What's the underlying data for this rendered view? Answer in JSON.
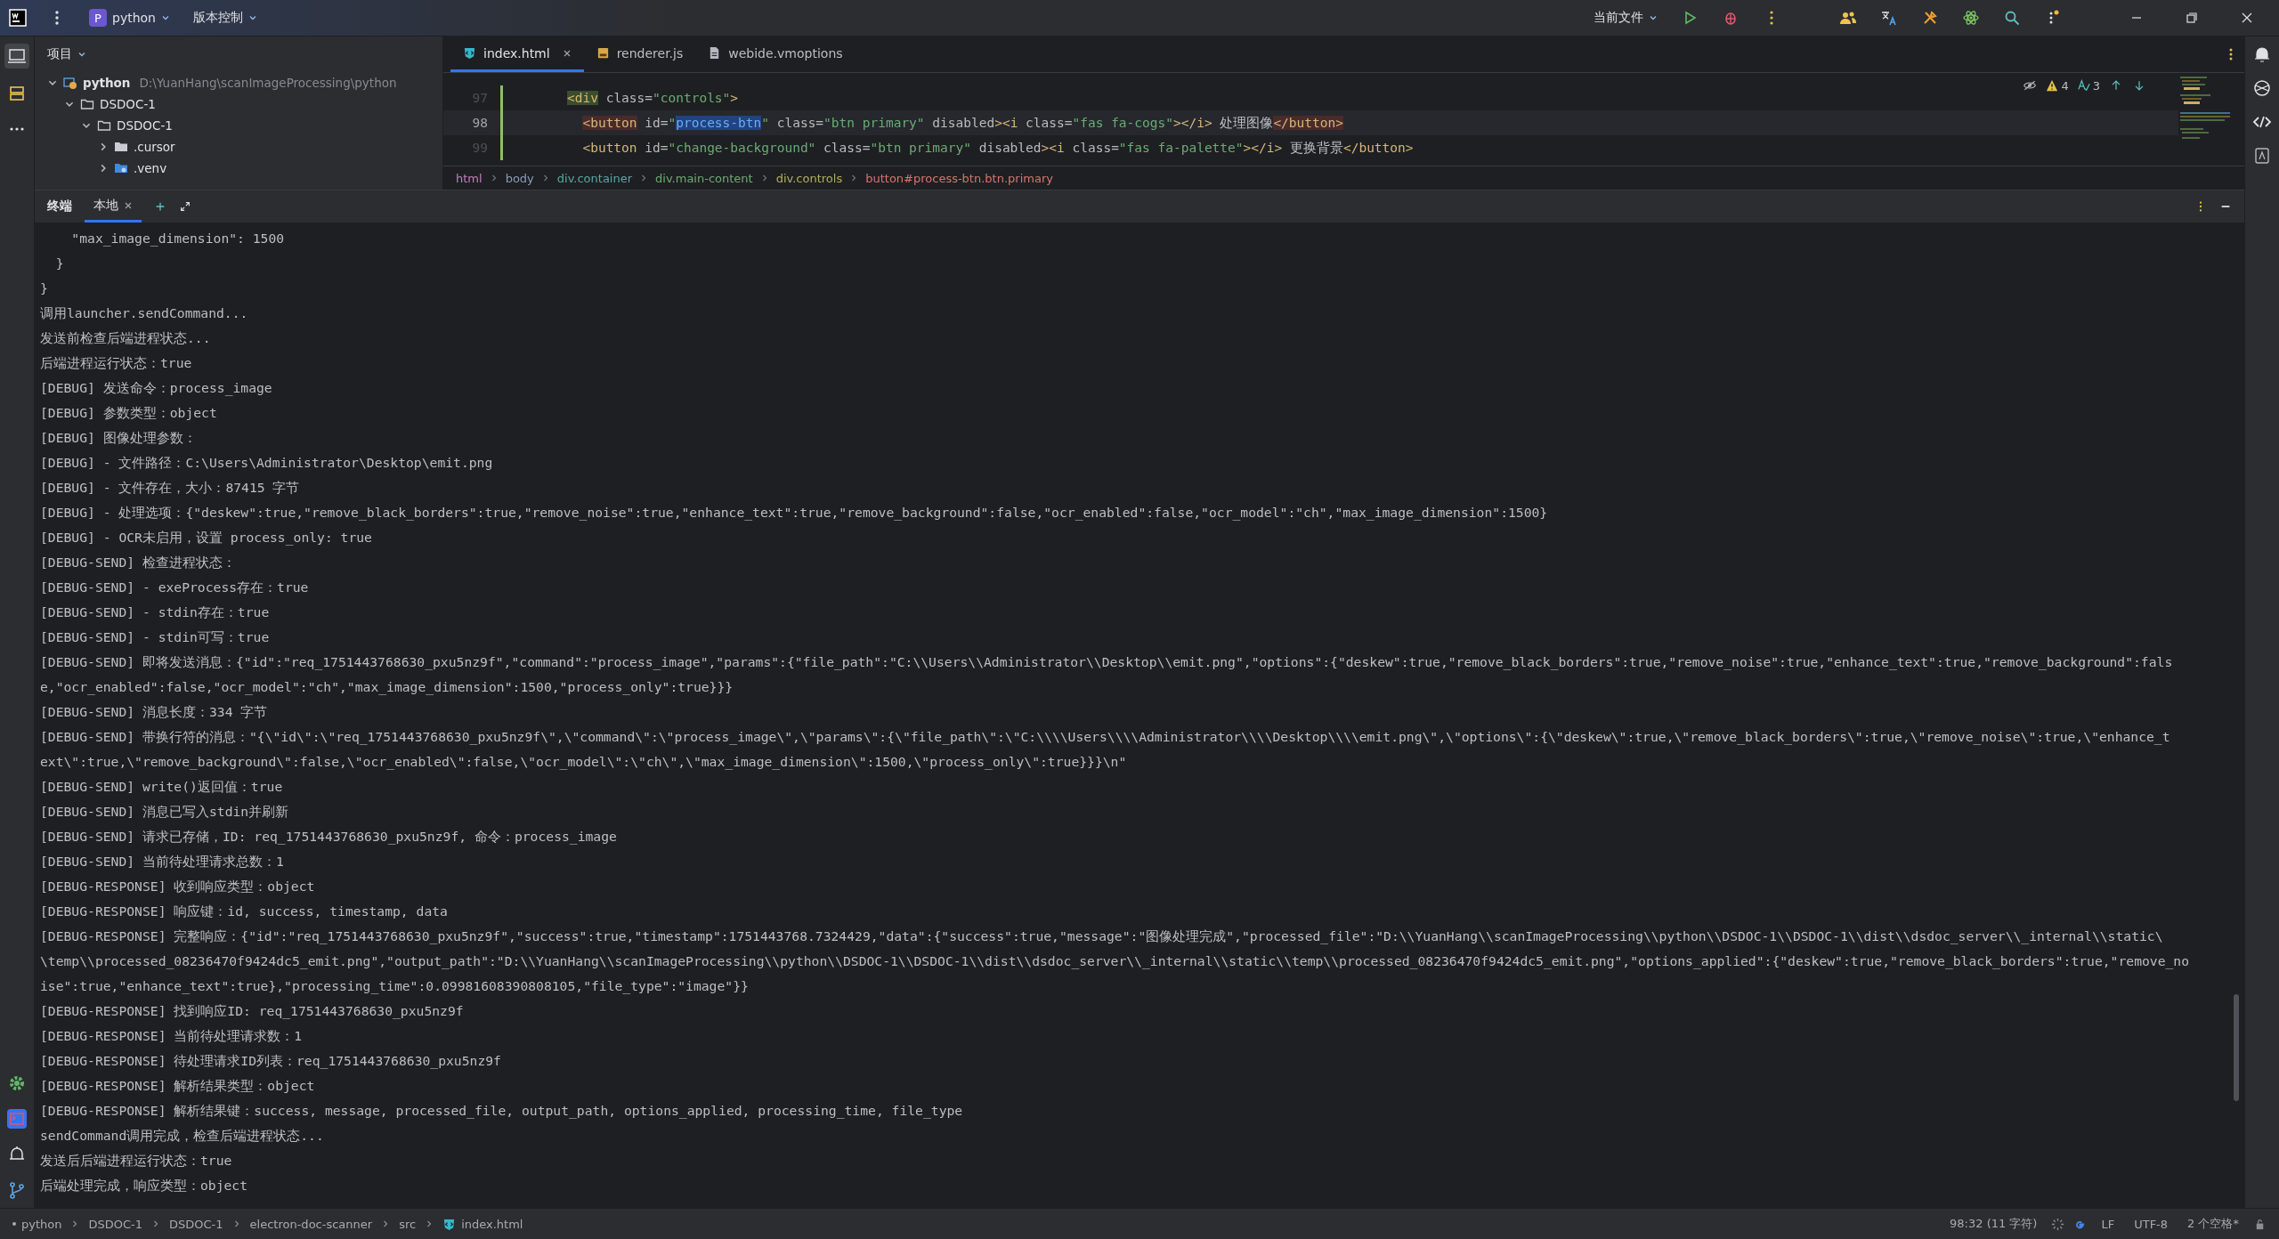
{
  "title_bar": {
    "project": {
      "badge": "P",
      "name": "python"
    },
    "vcs": "版本控制",
    "run_config": "当前文件"
  },
  "project_panel": {
    "title": "项目",
    "tree": [
      {
        "name": "python",
        "path": "D:\\YuanHang\\scanImageProcessing\\python",
        "kind": "module",
        "expanded": true,
        "children": [
          {
            "name": "DSDOC-1",
            "kind": "folder",
            "expanded": true,
            "children": [
              {
                "name": "DSDOC-1",
                "kind": "folder",
                "expanded": true,
                "children": [
                  {
                    "name": ".cursor",
                    "kind": "folder",
                    "expanded": false
                  },
                  {
                    "name": ".venv",
                    "kind": "venv",
                    "expanded": false
                  }
                ]
              }
            ]
          }
        ]
      }
    ]
  },
  "editor": {
    "tabs": [
      {
        "label": "index.html",
        "kind": "html",
        "selected": true,
        "closable": true
      },
      {
        "label": "renderer.js",
        "kind": "js",
        "selected": false,
        "closable": false
      },
      {
        "label": "webide.vmoptions",
        "kind": "file",
        "selected": false,
        "closable": false
      }
    ],
    "inspections": {
      "warnings": "4",
      "typos": "3"
    },
    "lines": [
      {
        "number": "97",
        "current": false,
        "tokens": [
          {
            "text": "<div",
            "kind": "tag-match"
          },
          {
            "text": " class=",
            "kind": "attr"
          },
          {
            "text": "\"controls\"",
            "kind": "value"
          },
          {
            "text": ">",
            "kind": "tag"
          }
        ]
      },
      {
        "number": "98",
        "current": true,
        "tokens": [
          {
            "text": "<button",
            "kind": "tag-pair"
          },
          {
            "text": " id=",
            "kind": "attr"
          },
          {
            "text": "\"",
            "kind": "value"
          },
          {
            "text": "process-btn",
            "kind": "selection"
          },
          {
            "text": "\"",
            "kind": "value"
          },
          {
            "text": " class=",
            "kind": "attr"
          },
          {
            "text": "\"btn primary\"",
            "kind": "value"
          },
          {
            "text": " disabled",
            "kind": "attr"
          },
          {
            "text": ">",
            "kind": "tag"
          },
          {
            "text": "<i",
            "kind": "tag"
          },
          {
            "text": " class=",
            "kind": "attr"
          },
          {
            "text": "\"fas fa-cogs\"",
            "kind": "value"
          },
          {
            "text": "></i>",
            "kind": "tag"
          },
          {
            "text": " 处理图像",
            "kind": "text"
          },
          {
            "text": "</button>",
            "kind": "tag-pair"
          }
        ]
      },
      {
        "number": "99",
        "current": false,
        "tokens": [
          {
            "text": "<button",
            "kind": "tag"
          },
          {
            "text": " id=",
            "kind": "attr"
          },
          {
            "text": "\"change-background\"",
            "kind": "value"
          },
          {
            "text": " class=",
            "kind": "attr"
          },
          {
            "text": "\"btn primary\"",
            "kind": "value"
          },
          {
            "text": " disabled",
            "kind": "attr"
          },
          {
            "text": ">",
            "kind": "tag"
          },
          {
            "text": "<i",
            "kind": "tag"
          },
          {
            "text": " class=",
            "kind": "attr"
          },
          {
            "text": "\"fas fa-palette\"",
            "kind": "value"
          },
          {
            "text": "></i>",
            "kind": "tag"
          },
          {
            "text": " 更换背景",
            "kind": "text"
          },
          {
            "text": "</button>",
            "kind": "tag"
          }
        ]
      }
    ],
    "breadcrumbs": [
      {
        "label": "html",
        "color": "#c77dbb"
      },
      {
        "label": "body",
        "color": "#8a9bb5"
      },
      {
        "label": "div.container",
        "color": "#56a8a5"
      },
      {
        "label": "div.main-content",
        "color": "#6aab73"
      },
      {
        "label": "div.controls",
        "color": "#b3ae60"
      },
      {
        "label": "button#process-btn.btn.primary",
        "color": "#d5756c"
      }
    ]
  },
  "terminal": {
    "title": "终端",
    "tabs": [
      {
        "label": "本地",
        "selected": true
      }
    ],
    "lines": [
      "    \"max_image_dimension\": 1500",
      "  }",
      "}",
      "调用launcher.sendCommand...",
      "发送前检查后端进程状态...",
      "后端进程运行状态：true",
      "[DEBUG] 发送命令：process_image",
      "[DEBUG] 参数类型：object",
      "[DEBUG] 图像处理参数：",
      "[DEBUG] - 文件路径：C:\\Users\\Administrator\\Desktop\\emit.png",
      "[DEBUG] - 文件存在，大小：87415 字节",
      "[DEBUG] - 处理选项：{\"deskew\":true,\"remove_black_borders\":true,\"remove_noise\":true,\"enhance_text\":true,\"remove_background\":false,\"ocr_enabled\":false,\"ocr_model\":\"ch\",\"max_image_dimension\":1500}",
      "[DEBUG] - OCR未启用，设置 process_only: true",
      "[DEBUG-SEND] 检查进程状态：",
      "[DEBUG-SEND] - exeProcess存在：true",
      "[DEBUG-SEND] - stdin存在：true",
      "[DEBUG-SEND] - stdin可写：true",
      "[DEBUG-SEND] 即将发送消息：{\"id\":\"req_1751443768630_pxu5nz9f\",\"command\":\"process_image\",\"params\":{\"file_path\":\"C:\\\\Users\\\\Administrator\\\\Desktop\\\\emit.png\",\"options\":{\"deskew\":true,\"remove_black_borders\":true,\"remove_noise\":true,\"enhance_text\":true,\"remove_background\":fals",
      "e,\"ocr_enabled\":false,\"ocr_model\":\"ch\",\"max_image_dimension\":1500,\"process_only\":true}}}",
      "[DEBUG-SEND] 消息长度：334 字节",
      "[DEBUG-SEND] 带换行符的消息：\"{\\\"id\\\":\\\"req_1751443768630_pxu5nz9f\\\",\\\"command\\\":\\\"process_image\\\",\\\"params\\\":{\\\"file_path\\\":\\\"C:\\\\\\\\Users\\\\\\\\Administrator\\\\\\\\Desktop\\\\\\\\emit.png\\\",\\\"options\\\":{\\\"deskew\\\":true,\\\"remove_black_borders\\\":true,\\\"remove_noise\\\":true,\\\"enhance_t",
      "ext\\\":true,\\\"remove_background\\\":false,\\\"ocr_enabled\\\":false,\\\"ocr_model\\\":\\\"ch\\\",\\\"max_image_dimension\\\":1500,\\\"process_only\\\":true}}}\\n\"",
      "[DEBUG-SEND] write()返回值：true",
      "[DEBUG-SEND] 消息已写入stdin并刷新",
      "[DEBUG-SEND] 请求已存储，ID: req_1751443768630_pxu5nz9f, 命令：process_image",
      "[DEBUG-SEND] 当前待处理请求总数：1",
      "[DEBUG-RESPONSE] 收到响应类型：object",
      "[DEBUG-RESPONSE] 响应键：id, success, timestamp, data",
      "[DEBUG-RESPONSE] 完整响应：{\"id\":\"req_1751443768630_pxu5nz9f\",\"success\":true,\"timestamp\":1751443768.7324429,\"data\":{\"success\":true,\"message\":\"图像处理完成\",\"processed_file\":\"D:\\\\YuanHang\\\\scanImageProcessing\\\\python\\\\DSDOC-1\\\\DSDOC-1\\\\dist\\\\dsdoc_server\\\\_internal\\\\static\\",
      "\\temp\\\\processed_08236470f9424dc5_emit.png\",\"output_path\":\"D:\\\\YuanHang\\\\scanImageProcessing\\\\python\\\\DSDOC-1\\\\DSDOC-1\\\\dist\\\\dsdoc_server\\\\_internal\\\\static\\\\temp\\\\processed_08236470f9424dc5_emit.png\",\"options_applied\":{\"deskew\":true,\"remove_black_borders\":true,\"remove_no",
      "ise\":true,\"enhance_text\":true},\"processing_time\":0.09981608390808105,\"file_type\":\"image\"}}",
      "[DEBUG-RESPONSE] 找到响应ID: req_1751443768630_pxu5nz9f",
      "[DEBUG-RESPONSE] 当前待处理请求数：1",
      "[DEBUG-RESPONSE] 待处理请求ID列表：req_1751443768630_pxu5nz9f",
      "[DEBUG-RESPONSE] 解析结果类型：object",
      "[DEBUG-RESPONSE] 解析结果键：success, message, processed_file, output_path, options_applied, processing_time, file_type",
      "sendCommand调用完成，检查后端进程状态...",
      "发送后后端进程运行状态：true",
      "后端处理完成，响应类型：object"
    ]
  },
  "status_bar": {
    "path": [
      {
        "label": "python",
        "kind": "module"
      },
      {
        "label": "DSDOC-1",
        "kind": "folder"
      },
      {
        "label": "DSDOC-1",
        "kind": "folder"
      },
      {
        "label": "electron-doc-scanner",
        "kind": "folder"
      },
      {
        "label": "src",
        "kind": "folder"
      },
      {
        "label": "index.html",
        "kind": "html"
      }
    ],
    "position": "98:32 (11 字符)",
    "line_separator": "LF",
    "encoding": "UTF-8",
    "indent": "2 个空格*"
  }
}
